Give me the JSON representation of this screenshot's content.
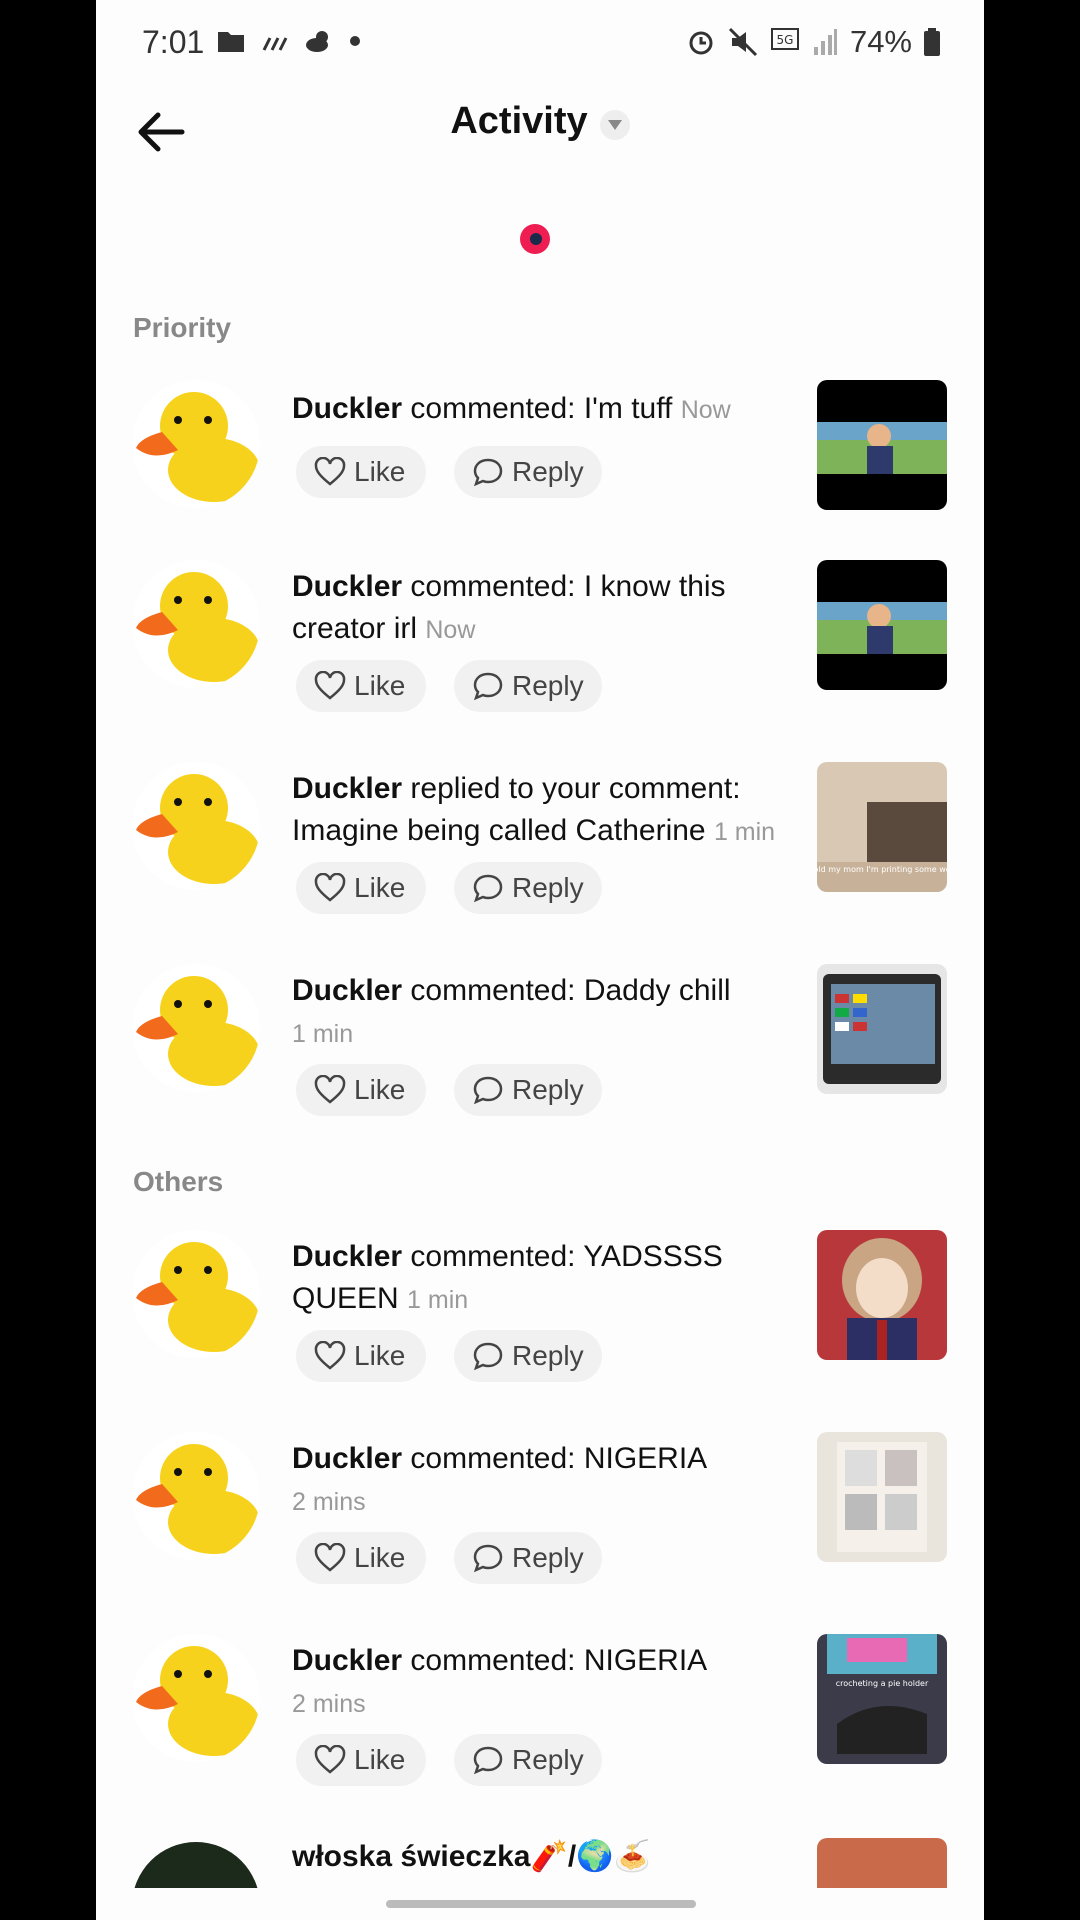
{
  "status_bar": {
    "time": "7:01",
    "battery": "74%",
    "network": "5G"
  },
  "header": {
    "title": "Activity"
  },
  "sections": {
    "priority": "Priority",
    "others": "Others"
  },
  "buttons": {
    "like": "Like",
    "reply": "Reply"
  },
  "notifications": [
    {
      "user": "Duckler",
      "action": "commented: I'm tuff",
      "time": "Now"
    },
    {
      "user": "Duckler",
      "action": "commented: I know this creator irl",
      "time": "Now"
    },
    {
      "user": "Duckler",
      "action": "replied to your comment: Imagine being called Catherine",
      "time": "1 min"
    },
    {
      "user": "Duckler",
      "action": "commented: Daddy chill",
      "time": "1 min"
    },
    {
      "user": "Duckler",
      "action": "commented: YADSSSS QUEEN",
      "time": "1 min"
    },
    {
      "user": "Duckler",
      "action": "commented: NIGERIA",
      "time": "2 mins"
    },
    {
      "user": "Duckler",
      "action": "commented: NIGERIA",
      "time": "2 mins"
    }
  ],
  "partial_row": {
    "user": "włoska świeczka🧨/🌍🍝"
  },
  "thumb_captions": {
    "t2": "I told my mom I'm printing some work",
    "t6": "crocheting a pie holder"
  },
  "colors": {
    "accent": "#ee1d52",
    "duck_yellow": "#f7d21c",
    "beak": "#f26a1b"
  }
}
